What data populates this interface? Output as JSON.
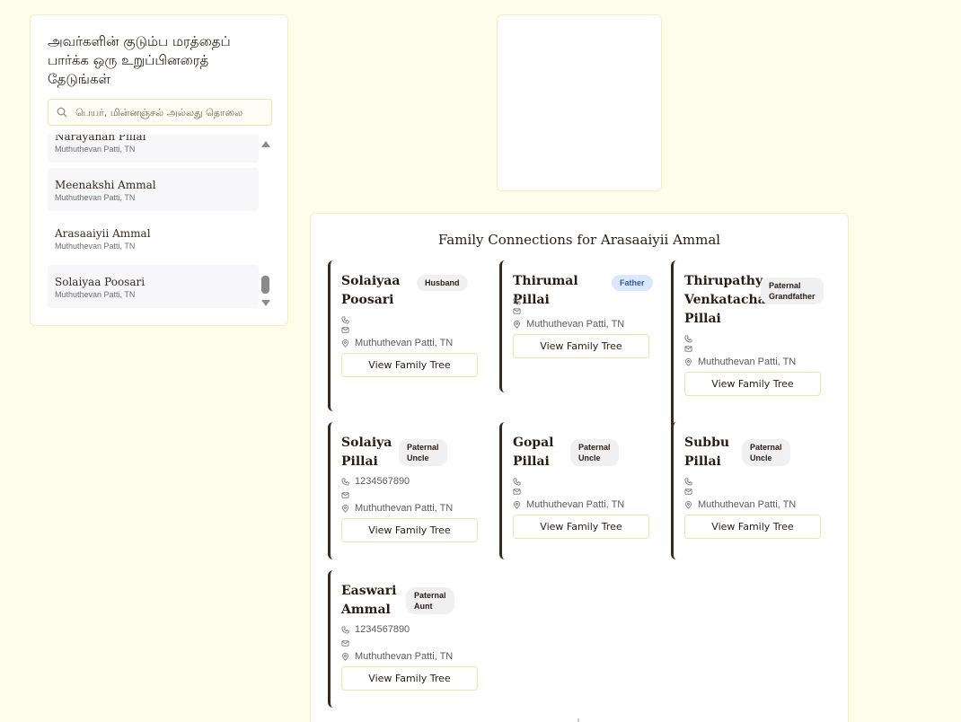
{
  "search": {
    "title": "அவர்களின் குடும்ப மரத்தைப் பார்க்க ஒரு உறுப்பினரைத் தேடுங்கள்",
    "placeholder": "பெயர், மின்னஞ்சல் அல்லது தொலை"
  },
  "results": [
    {
      "name": "Narayanan Pillai",
      "location": "Muthuthevan Patti, TN"
    },
    {
      "name": "Meenakshi Ammal",
      "location": "Muthuthevan Patti, TN"
    },
    {
      "name": "Arasaaiyii Ammal",
      "location": "Muthuthevan Patti, TN"
    },
    {
      "name": "Solaiyaa Poosari",
      "location": "Muthuthevan Patti, TN"
    }
  ],
  "connections": {
    "title": "Family Connections for Arasaaiyii Ammal",
    "view_label": "View Family Tree",
    "cards": [
      {
        "name_lines": [
          "Solaiyaa",
          "Poosari"
        ],
        "relation_lines": [
          "Husband"
        ],
        "phone": "",
        "location": "Muthuthevan Patti, TN"
      },
      {
        "name_lines": [
          "Thirumal Pillai"
        ],
        "relation_lines": [
          "Father"
        ],
        "phone": "",
        "location": "Muthuthevan Patti, TN"
      },
      {
        "name_lines": [
          "Thirupathy",
          "Venkatachalam",
          "Pillai"
        ],
        "relation_lines": [
          "Paternal",
          "Grandfather"
        ],
        "phone": "",
        "location": "Muthuthevan Patti, TN"
      },
      {
        "name_lines": [
          "Solaiya",
          "Pillai"
        ],
        "relation_lines": [
          "Paternal",
          "Uncle"
        ],
        "phone": "1234567890",
        "location": "Muthuthevan Patti, TN"
      },
      {
        "name_lines": [
          "Gopal",
          "Pillai"
        ],
        "relation_lines": [
          "Paternal",
          "Uncle"
        ],
        "phone": "",
        "location": "Muthuthevan Patti, TN"
      },
      {
        "name_lines": [
          "Subbu",
          "Pillai"
        ],
        "relation_lines": [
          "Paternal",
          "Uncle"
        ],
        "phone": "",
        "location": "Muthuthevan Patti, TN"
      },
      {
        "name_lines": [
          "Easwari",
          "Ammal"
        ],
        "relation_lines": [
          "Paternal",
          "Aunt"
        ],
        "phone": "1234567890",
        "location": "Muthuthevan Patti, TN"
      }
    ]
  }
}
